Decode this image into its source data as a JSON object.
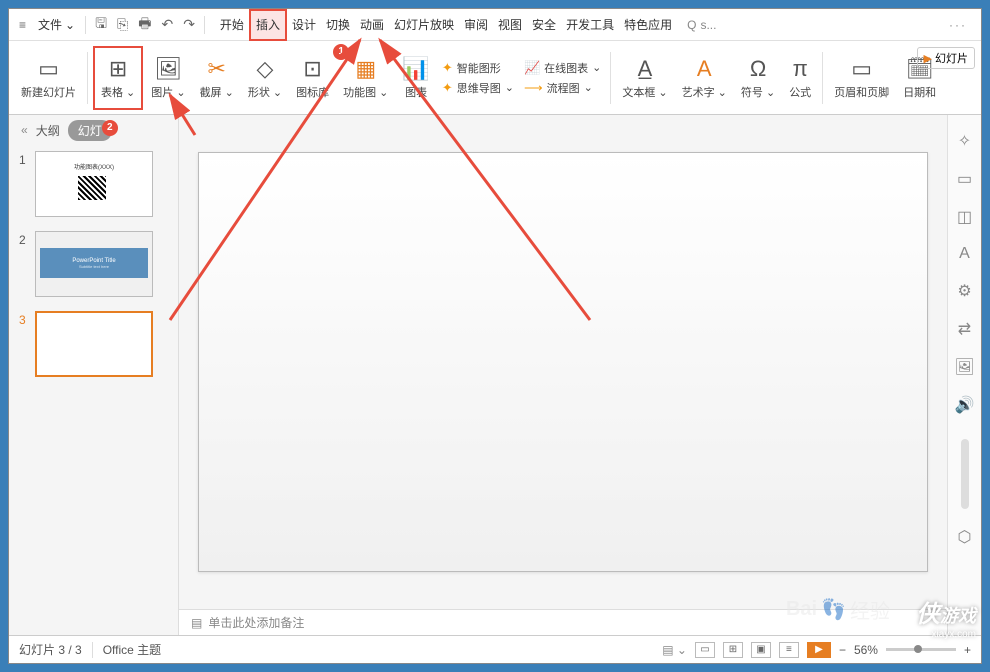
{
  "menubar": {
    "file": "文件",
    "tabs": [
      "开始",
      "插入",
      "设计",
      "切换",
      "动画",
      "幻灯片放映",
      "审阅",
      "视图",
      "安全",
      "开发工具",
      "特色应用"
    ],
    "active_tab_index": 1,
    "search_prefix": "s...",
    "search_icon": "Q"
  },
  "ribbon": {
    "new_slide": "新建幻灯片",
    "table": "表格",
    "picture": "图片",
    "screenshot": "截屏",
    "shapes": "形状",
    "icon_lib": "图标库",
    "func_chart": "功能图",
    "chart": "图表",
    "smart_graphic": "智能图形",
    "online_chart": "在线图表",
    "flowchart": "流程图",
    "mindmap": "思维导图",
    "textbox": "文本框",
    "wordart": "艺术字",
    "symbol": "符号",
    "formula": "公式",
    "header_footer": "页眉和页脚",
    "date_time": "日期和",
    "slide_show_btn": "幻灯片"
  },
  "badges": {
    "b1": "1",
    "b2": "2"
  },
  "sidebar": {
    "outline_tab": "大纲",
    "slides_tab": "幻灯",
    "thumbs": [
      {
        "num": "1",
        "title": "功能图表(XXX)"
      },
      {
        "num": "2",
        "title": "PowerPoint Title",
        "subtitle": "Subtitle text here"
      },
      {
        "num": "3"
      }
    ]
  },
  "notes": {
    "placeholder": "单击此处添加备注"
  },
  "statusbar": {
    "slide_info": "幻灯片 3 / 3",
    "theme": "Office 主题",
    "zoom": "56%"
  },
  "watermark": {
    "brand_cn": "经验",
    "site": "xiayx.com",
    "game": "游戏",
    "baidu": "Baidu"
  }
}
